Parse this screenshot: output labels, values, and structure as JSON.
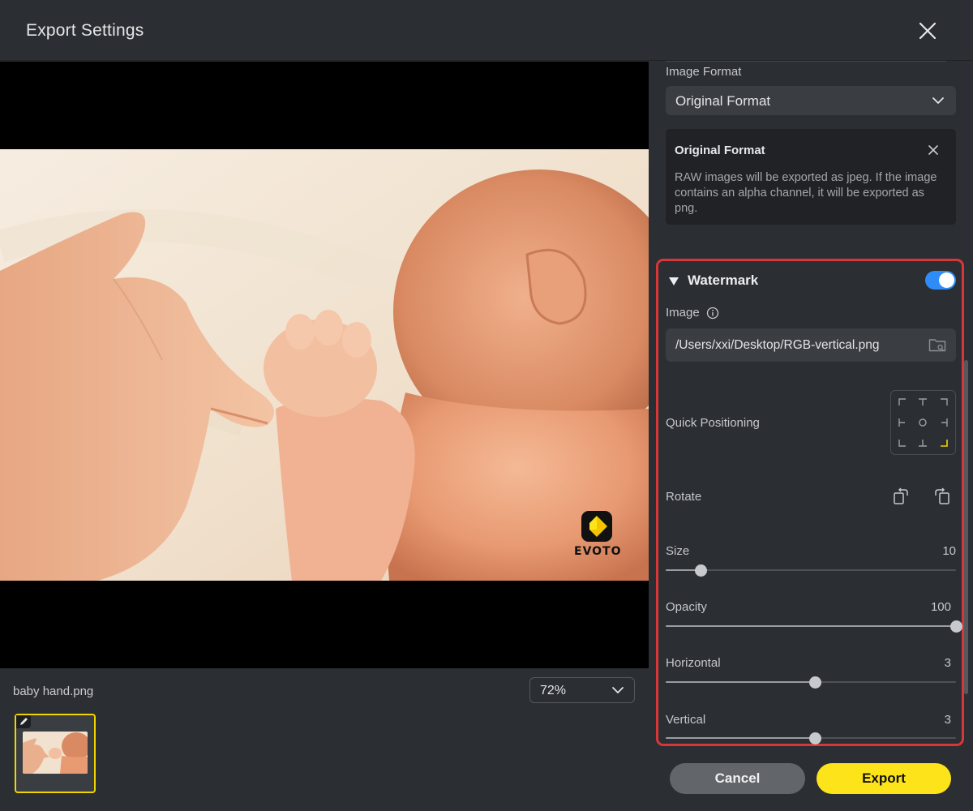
{
  "dialog": {
    "title": "Export Settings"
  },
  "preview": {
    "filename": "baby hand.png",
    "zoom": "72%",
    "watermark_text": "EVOTO"
  },
  "panel": {
    "image_format": {
      "label": "Image Format",
      "selected": "Original Format"
    },
    "info": {
      "title": "Original Format",
      "body": "RAW images will be exported as jpeg. If the image contains an alpha channel, it will be exported as png."
    },
    "watermark": {
      "title": "Watermark",
      "enabled": true,
      "image_label": "Image",
      "image_path": "/Users/xxi/Desktop/RGB-vertical.png",
      "quick_positioning_label": "Quick Positioning",
      "selected_position": "bottom-right",
      "rotate_label": "Rotate",
      "sliders": [
        {
          "label": "Size",
          "value": "10",
          "fraction": 0.12
        },
        {
          "label": "Opacity",
          "value": "100",
          "fraction": 1.0
        },
        {
          "label": "Horizontal",
          "value": "3",
          "fraction": 0.515
        },
        {
          "label": "Vertical",
          "value": "3",
          "fraction": 0.515
        }
      ]
    }
  },
  "buttons": {
    "cancel": "Cancel",
    "export": "Export"
  },
  "colors": {
    "accent_yellow": "#fde319",
    "toggle_blue": "#2f8cf6",
    "highlight_red": "#d9363a",
    "background": "#2b2e32"
  }
}
